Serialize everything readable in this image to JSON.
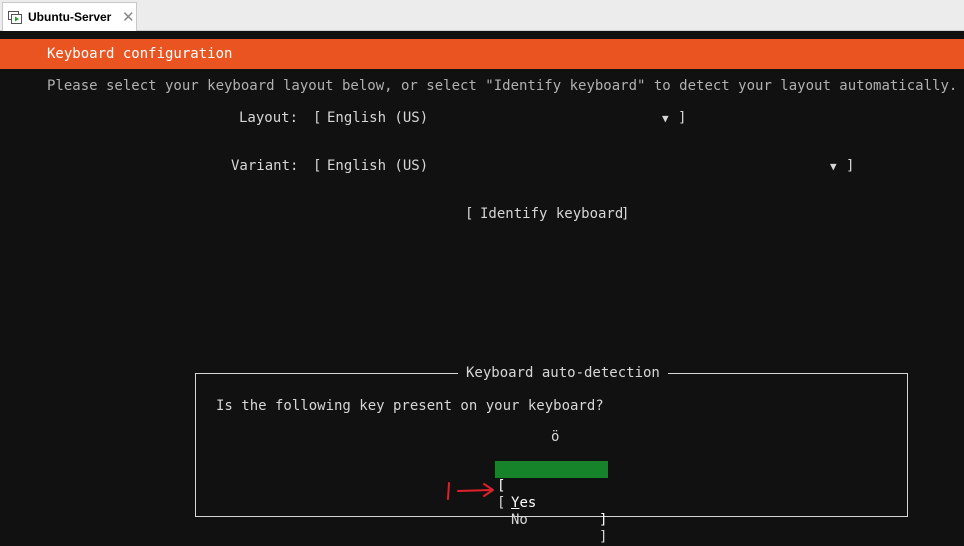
{
  "window": {
    "tab_label": "Ubuntu-Server",
    "tab_icon": "vm-icon",
    "close_glyph": "✕"
  },
  "installer": {
    "header_title": "Keyboard configuration",
    "description": "Please select your keyboard layout below, or select \"Identify keyboard\" to detect your layout automatically.",
    "layout": {
      "label": "Layout:",
      "value": "English (US)"
    },
    "variant": {
      "label": "Variant:",
      "value": "English (US)"
    },
    "identify_button": "Identify keyboard",
    "dropdown_arrow": "▼",
    "bracket_open": "[",
    "bracket_close": "]"
  },
  "dialog": {
    "title": "Keyboard auto-detection",
    "question": "Is the following key present on your keyboard?",
    "key": "ö",
    "yes_label_first": "Y",
    "yes_label_rest": "es",
    "no_label": "No"
  },
  "colors": {
    "header_bg": "#e95420",
    "selected_button_bg": "#16822a",
    "annotation": "#e0202a"
  },
  "annotation": {
    "marker": "1"
  }
}
